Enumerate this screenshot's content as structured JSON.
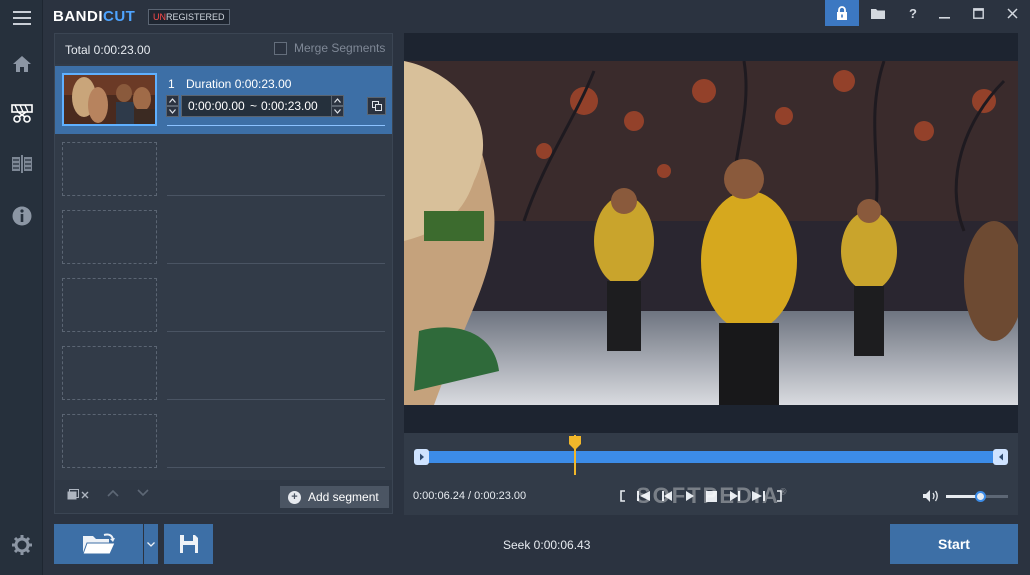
{
  "app": {
    "logo_main": "BANDI",
    "logo_accent": "CUT",
    "badge_red": "UN",
    "badge_rest": "REGISTERED"
  },
  "sidebar": {
    "items": [
      {
        "icon": "menu-icon"
      },
      {
        "icon": "home-icon"
      },
      {
        "icon": "cut-icon",
        "active": true
      },
      {
        "icon": "join-icon"
      },
      {
        "icon": "info-icon"
      },
      {
        "icon": "settings-icon"
      }
    ]
  },
  "titlebar": {
    "buttons": [
      "lock-icon",
      "folder-icon",
      "help-icon",
      "minimize-icon",
      "maximize-icon",
      "close-icon"
    ],
    "help_label": "?"
  },
  "segments": {
    "total_label": "Total 0:00:23.00",
    "merge_label": "Merge Segments",
    "merge_checked": false,
    "items": [
      {
        "index": "1",
        "duration_label": "Duration 0:00:23.00",
        "start": "0:00:00.00",
        "separator": "~",
        "end": "0:00:23.00"
      }
    ],
    "empty_slots": 5,
    "add_label": "Add segment"
  },
  "player": {
    "timecode": "0:00:06.24 / 0:00:23.00",
    "position_fraction": 0.271,
    "volume_fraction": 0.55,
    "watermark": "SOFTPEDIA",
    "watermark_mark": "®"
  },
  "bottom": {
    "seek_label": "Seek 0:00:06.43",
    "start_label": "Start"
  },
  "colors": {
    "accent": "#3d6fa6",
    "track": "#3c8ce8",
    "playhead": "#f1b72a",
    "background": "#2b3340"
  }
}
